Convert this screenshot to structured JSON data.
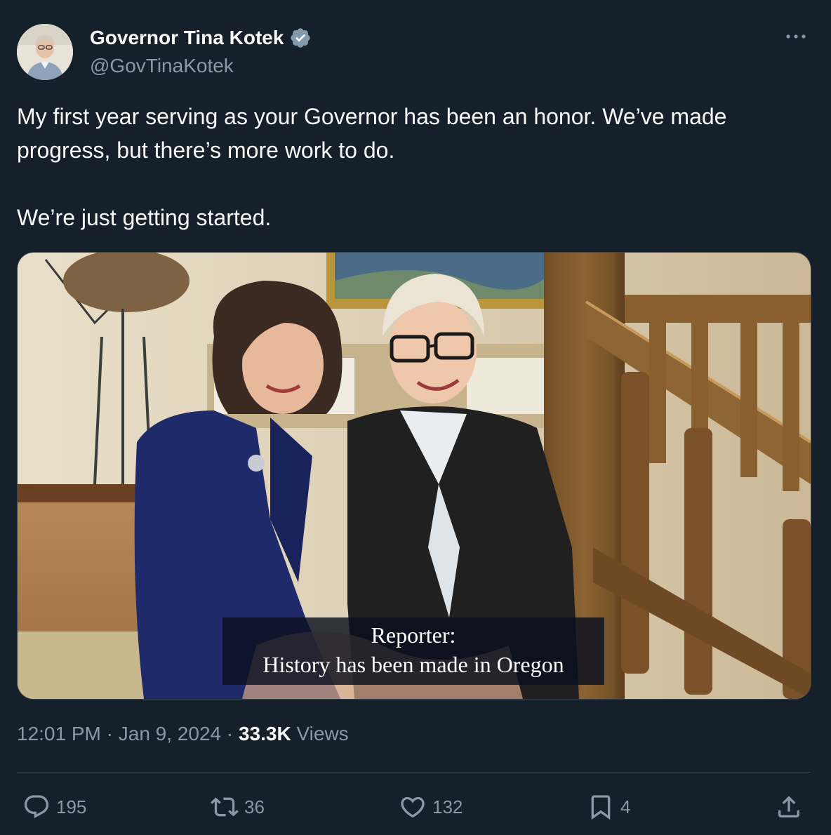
{
  "tweet": {
    "author": {
      "name": "Governor Tina Kotek",
      "handle": "@GovTinaKotek",
      "verified_icon": "verified-badge-icon"
    },
    "text": {
      "line1": "My first year serving as your Governor has been an honor. We’ve made",
      "line2": "progress, but there’s more work to do.",
      "line3": "We’re just getting started."
    },
    "media": {
      "caption": {
        "line1": "Reporter:",
        "line2": "History has been made in Oregon"
      }
    },
    "meta": {
      "time": "12:01 PM",
      "separator": "·",
      "date": "Jan 9, 2024",
      "views_count": "33.3K",
      "views_label": "Views"
    },
    "actions": {
      "replies": "195",
      "reposts": "36",
      "likes": "132",
      "bookmarks": "4"
    }
  },
  "colors": {
    "background": "#15202b",
    "text_primary": "#f7f9f9",
    "text_secondary": "#8b98a5",
    "verified": "#829aab",
    "border": "#38444d"
  }
}
